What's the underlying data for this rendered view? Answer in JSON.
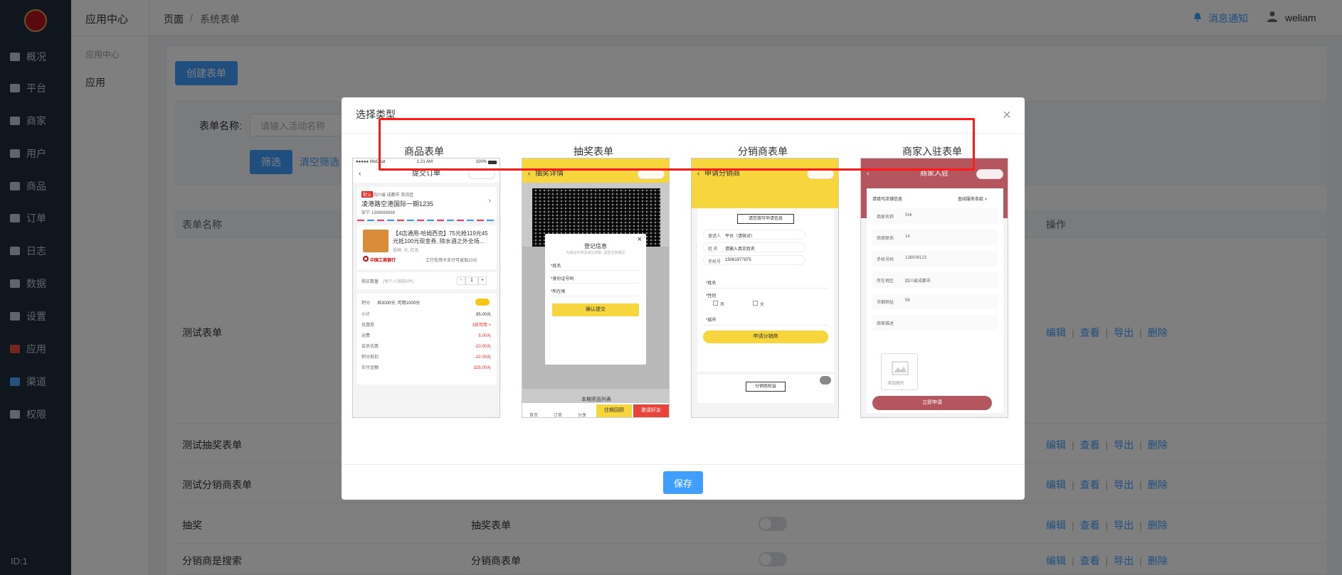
{
  "sidebar": {
    "items": [
      {
        "label": "概况",
        "icon": "monitor-icon"
      },
      {
        "label": "平台",
        "icon": "desktop-icon"
      },
      {
        "label": "商家",
        "icon": "store-icon"
      },
      {
        "label": "用户",
        "icon": "user-icon"
      },
      {
        "label": "商品",
        "icon": "goods-icon"
      },
      {
        "label": "订单",
        "icon": "order-icon"
      },
      {
        "label": "日志",
        "icon": "log-icon"
      },
      {
        "label": "数据",
        "icon": "bar-chart-icon"
      },
      {
        "label": "设置",
        "icon": "gear-icon"
      },
      {
        "label": "应用",
        "icon": "apps-grid-icon"
      },
      {
        "label": "渠道",
        "icon": "cube-icon"
      },
      {
        "label": "权限",
        "icon": "lock-icon"
      }
    ],
    "id_text": "ID:1"
  },
  "subnav": {
    "title": "应用中心",
    "group": "应用中心",
    "item": "应用"
  },
  "header": {
    "breadcrumb_home": "页面",
    "breadcrumb_sep": "/",
    "breadcrumb_current": "系统表单",
    "notice": "消息通知",
    "username": "weliam"
  },
  "toolbar": {
    "create_label": "创建表单",
    "form_name_label": "表单名称:",
    "form_name_placeholder": "请输入活动名称",
    "filter_label": "筛选",
    "clear_label": "清空筛选"
  },
  "table": {
    "headers": {
      "name": "表单名称",
      "ops": "操作"
    },
    "rows": [
      {
        "name": "测试表单",
        "type": "",
        "toggle": false,
        "show_toggle": false
      },
      {
        "name": "测试抽奖表单",
        "type": "",
        "toggle": false,
        "show_toggle": false
      },
      {
        "name": "测试分销商表单",
        "type": "",
        "toggle": false,
        "show_toggle": false
      },
      {
        "name": "抽奖",
        "type": "抽奖表单",
        "toggle": false,
        "show_toggle": true
      },
      {
        "name": "分销商是搜索",
        "type": "分销商表单",
        "toggle": false,
        "show_toggle": true
      }
    ],
    "ops": {
      "edit": "编辑",
      "view": "查看",
      "export": "导出",
      "delete": "删除",
      "sep": "|"
    }
  },
  "modal": {
    "title": "选择类型",
    "close": "×",
    "save_label": "保存",
    "types": [
      {
        "label": "商品表单"
      },
      {
        "label": "抽奖表单"
      },
      {
        "label": "分销商表单"
      },
      {
        "label": "商家入驻表单"
      }
    ]
  },
  "thumb_goods": {
    "status_left": "●●●●● WeChat",
    "status_time": "1:21 AM",
    "status_right": "100%",
    "nav_title": "提交订单",
    "addr_tag": "默认",
    "addr_region": "四川省  成都市  双流区",
    "addr_line": "凌港路空港国际一期1235",
    "addr_contact": "安宁   1388888888",
    "product_title": "【4店通用-哈姆西克】75元抢119元45元抵100元现金券, 除水酒之外全场...",
    "product_spec": "规格: 大, 红色",
    "bank_name": "中国工商银行",
    "bank_note": "工行信用卡支付可返现10元",
    "qty_label": "购买数量",
    "qty_hint": "(每个人限购5件)",
    "qty_value": "1",
    "points_label": "积分",
    "points_text": "共3000分, 可用1000分",
    "fee_rows": [
      {
        "k": "小计",
        "v": "85.00元"
      },
      {
        "k": "优惠券",
        "v": "3张可用 >"
      },
      {
        "k": "运费",
        "v": "5.00元"
      },
      {
        "k": "会员优惠",
        "v": "-10.00元"
      },
      {
        "k": "积分抵扣",
        "v": "-22.00元"
      },
      {
        "k": "实付金额",
        "v": "325.00元"
      }
    ]
  },
  "thumb_lottery": {
    "nav_title": "抽奖详情",
    "dialog_title": "登记信息",
    "dialog_sub": "为保证中奖及成功领取, 请您注意填写",
    "fields": [
      "*姓名",
      "*身份证号码",
      "*所在地"
    ],
    "confirm": "确认提交",
    "list_title": "本期奖品列表",
    "tabs": [
      "首页",
      "订单",
      "分享"
    ],
    "btn_record": "往期回顾",
    "btn_invite": "邀请好友"
  },
  "thumb_dist": {
    "nav_title": "申请分销商",
    "form_title": "请您填写申请信息",
    "rows": [
      {
        "k": "邀请人",
        "v": "平台（请核对）"
      },
      {
        "k": "姓 名",
        "v": "请输入真实姓名"
      },
      {
        "k": "手机号",
        "v": "15061977875"
      }
    ],
    "name_field": "*姓名",
    "gender_label": "*性别",
    "male": "男",
    "female": "女",
    "city_field": "*城市",
    "apply_btn": "申请分销商",
    "benefits_btn": "分销商权益"
  },
  "thumb_merchant": {
    "nav_title": "商家入驻",
    "section_title": "请填写店铺信息",
    "section_link": "查阅服务条款 >",
    "rows": [
      {
        "k": "商家名称",
        "v": "5#k"
      },
      {
        "k": "商家联系",
        "v": "14"
      },
      {
        "k": "手机号码",
        "v": "138008123"
      },
      {
        "k": "所在地区",
        "v": "四川省成都市"
      },
      {
        "k": "详细地址",
        "v": "58"
      },
      {
        "k": "商家描述",
        "v": ""
      }
    ],
    "upload_label": "添加图片",
    "submit": "立即申请"
  },
  "colors": {
    "sidebar_bg": "#1f2d3d",
    "primary": "#409eff",
    "highlight": "#ff1a1a",
    "lottery_yellow": "#f7d53d",
    "merchant_red": "#b5565e"
  }
}
